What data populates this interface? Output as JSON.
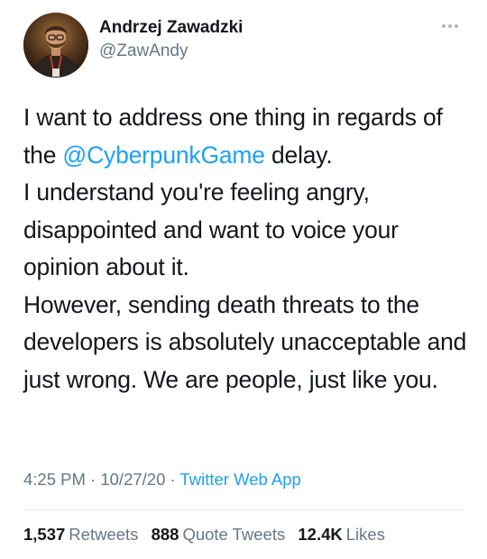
{
  "author": {
    "name": "Andrzej Zawadzki",
    "handle": "@ZawAndy"
  },
  "more_icon": "more-horizontal-icon",
  "tweet": {
    "line1_before": "I want to address one thing in regards of the ",
    "mention": "@CyberpunkGame",
    "line1_after": " delay.",
    "para2": "I understand you're feeling angry, disappointed and want to voice your opinion about it.",
    "para3": "However, sending death threats to the developers is absolutely unacceptable and just wrong. We are people, just like you."
  },
  "meta": {
    "time": "4:25 PM",
    "sep1": " · ",
    "date": "10/27/20",
    "sep2": " · ",
    "source": "Twitter Web App"
  },
  "stats": {
    "retweets_count": "1,537",
    "retweets_label": "Retweets",
    "quotes_count": "888",
    "quotes_label": "Quote Tweets",
    "likes_count": "12.4K",
    "likes_label": "Likes"
  },
  "colors": {
    "link": "#1da1f2",
    "secondary": "#657786",
    "primary": "#14171a",
    "divider": "#e1e8ed"
  }
}
